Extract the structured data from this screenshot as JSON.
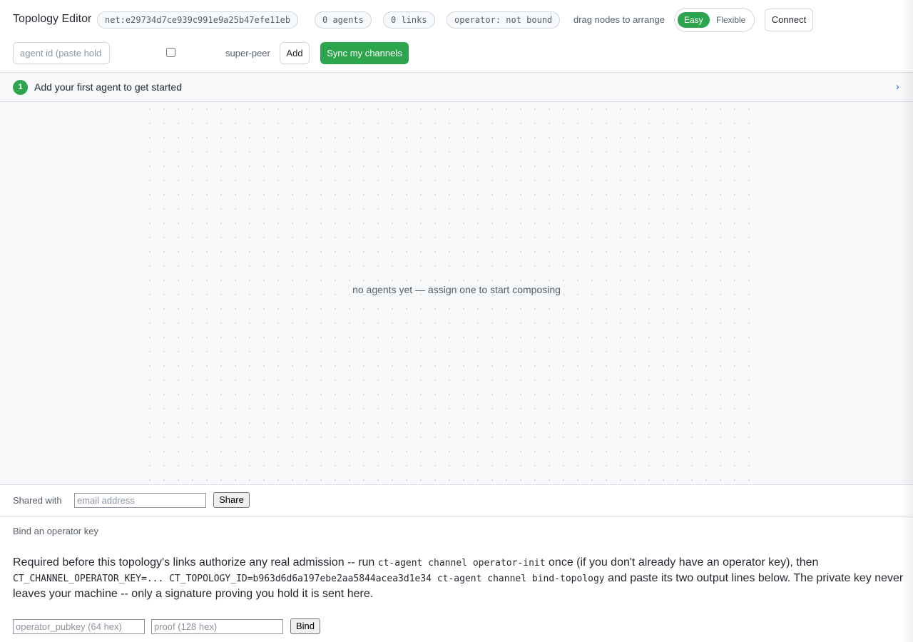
{
  "header": {
    "title": "Topology Editor",
    "network_id": "net:e29734d7ce939c991e9a25b47efe11eb",
    "agents_count": "0 agents",
    "links_count": "0 links",
    "operator_status": "operator: not bound",
    "drag_hint": "drag nodes to arrange",
    "mode_easy": "Easy",
    "mode_flexible": "Flexible",
    "active_mode": "Easy",
    "connect_label": "Connect"
  },
  "agent_form": {
    "agent_id_placeholder": "agent id (paste hold",
    "super_peer_label": "super-peer",
    "add_label": "Add",
    "sync_label": "Sync my channels"
  },
  "banner": {
    "step": "1",
    "text": "Add your first agent to get started",
    "chevron": "›"
  },
  "canvas": {
    "empty_message": "no agents yet — assign one to start composing"
  },
  "share": {
    "label": "Shared with",
    "email_placeholder": "email address",
    "share_label": "Share"
  },
  "bind": {
    "title": "Bind an operator key",
    "desc_1": "Required before this topology's links authorize any real admission -- run ",
    "code_1": "ct-agent channel operator-init",
    "desc_2": " once (if you don't already have an operator key), then ",
    "code_2": "CT_CHANNEL_OPERATOR_KEY=... CT_TOPOLOGY_ID=b963d6d6a197ebe2aa5844acea3d1e34 ct-agent channel bind-topology",
    "desc_3": " and paste its two output lines below. The private key never leaves your machine -- only a signature proving you hold it is sent here.",
    "pubkey_placeholder": "operator_pubkey (64 hex)",
    "proof_placeholder": "proof (128 hex)",
    "bind_label": "Bind"
  },
  "colors": {
    "accent": "#2da44e",
    "link": "#0969da",
    "muted_text": "#57606a",
    "canvas_bg": "#f6f8fa"
  }
}
